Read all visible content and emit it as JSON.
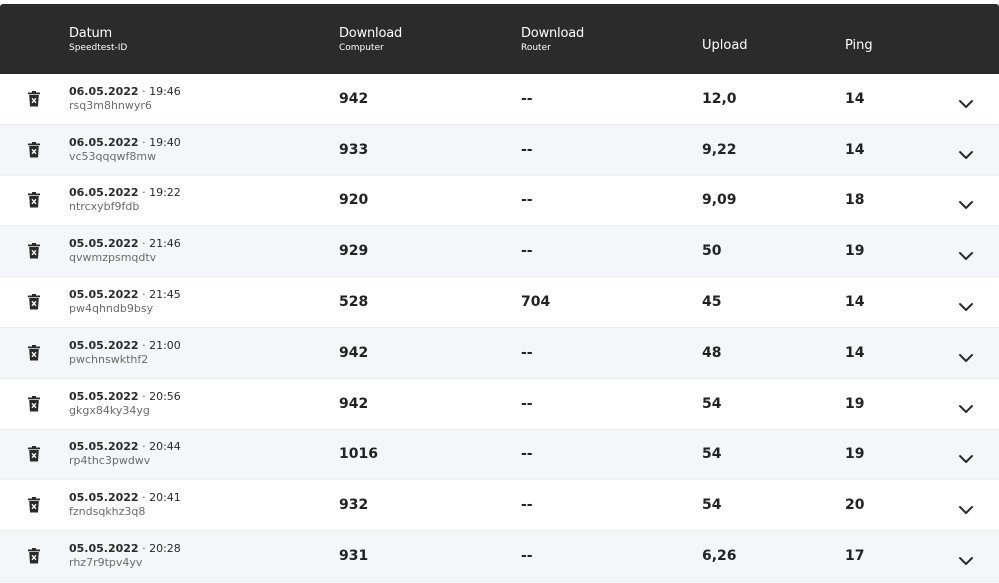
{
  "header": {
    "col_date": "Datum",
    "col_date_sub": "Speedtest-ID",
    "col_dl_computer": "Download",
    "col_dl_computer_sub": "Computer",
    "col_dl_router": "Download",
    "col_dl_router_sub": "Router",
    "col_upload": "Upload",
    "col_ping": "Ping"
  },
  "separator": " · ",
  "rows": [
    {
      "date": "06.05.2022",
      "time": "19:46",
      "id": "rsq3m8hnwyr6",
      "download_computer": "942",
      "download_router": "--",
      "upload": "12,0",
      "ping": "14"
    },
    {
      "date": "06.05.2022",
      "time": "19:40",
      "id": "vc53qqqwf8mw",
      "download_computer": "933",
      "download_router": "--",
      "upload": "9,22",
      "ping": "14"
    },
    {
      "date": "06.05.2022",
      "time": "19:22",
      "id": "ntrcxybf9fdb",
      "download_computer": "920",
      "download_router": "--",
      "upload": "9,09",
      "ping": "18"
    },
    {
      "date": "05.05.2022",
      "time": "21:46",
      "id": "qvwmzpsmqdtv",
      "download_computer": "929",
      "download_router": "--",
      "upload": "50",
      "ping": "19"
    },
    {
      "date": "05.05.2022",
      "time": "21:45",
      "id": "pw4qhndb9bsy",
      "download_computer": "528",
      "download_router": "704",
      "upload": "45",
      "ping": "14"
    },
    {
      "date": "05.05.2022",
      "time": "21:00",
      "id": "pwchnswkthf2",
      "download_computer": "942",
      "download_router": "--",
      "upload": "48",
      "ping": "14"
    },
    {
      "date": "05.05.2022",
      "time": "20:56",
      "id": "gkgx84ky34yg",
      "download_computer": "942",
      "download_router": "--",
      "upload": "54",
      "ping": "19"
    },
    {
      "date": "05.05.2022",
      "time": "20:44",
      "id": "rp4thc3pwdwv",
      "download_computer": "1016",
      "download_router": "--",
      "upload": "54",
      "ping": "19"
    },
    {
      "date": "05.05.2022",
      "time": "20:41",
      "id": "fzndsqkhz3q8",
      "download_computer": "932",
      "download_router": "--",
      "upload": "54",
      "ping": "20"
    },
    {
      "date": "05.05.2022",
      "time": "20:28",
      "id": "rhz7r9tpv4yv",
      "download_computer": "931",
      "download_router": "--",
      "upload": "6,26",
      "ping": "17"
    }
  ]
}
